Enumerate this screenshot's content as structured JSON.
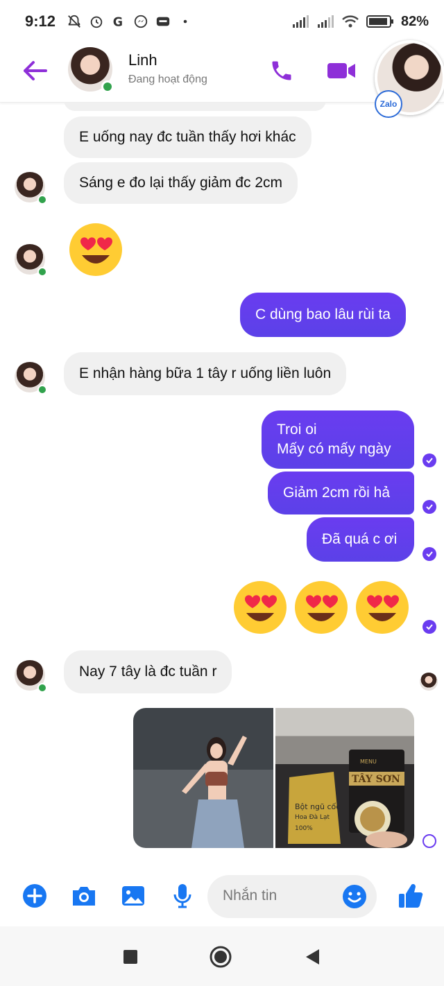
{
  "status_bar": {
    "time": "9:12",
    "battery": "82%"
  },
  "header": {
    "contact_name": "Linh",
    "contact_status": "Đang hoạt động",
    "accent_color": "#8e2fd8"
  },
  "float_bubble": {
    "badge": "Zalo"
  },
  "messages": [
    {
      "from": "them",
      "text": "E uống nay đc tuần thấy hơi khác"
    },
    {
      "from": "them",
      "text": "Sáng e đo lại thấy giảm đc 2cm"
    },
    {
      "from": "them",
      "type": "emoji",
      "emoji": "heart-eyes"
    },
    {
      "from": "me",
      "text": "C dùng bao lâu rùi ta"
    },
    {
      "from": "them",
      "text": "E nhận hàng bữa 1 tây r uống liền luôn"
    },
    {
      "from": "me",
      "lines": [
        "Troi oi",
        "Mấy có mấy ngày"
      ]
    },
    {
      "from": "me",
      "text": "Giảm 2cm rồi hả"
    },
    {
      "from": "me",
      "text": "Đã quá c ơi"
    },
    {
      "from": "me",
      "type": "emoji",
      "emoji": "heart-eyes",
      "count": 3
    },
    {
      "from": "them",
      "text": "Nay 7 tây là đc tuần r"
    },
    {
      "from": "me",
      "type": "photos",
      "count": 2
    }
  ],
  "photo_labels": {
    "menu": "MENU",
    "brand": "TÂY SƠN",
    "pack_line1": "Bột ngũ cốc",
    "pack_line2": "Hoa Đà Lạt",
    "pack_pct": "100%"
  },
  "composer": {
    "placeholder": "Nhắn tin"
  },
  "colors": {
    "outgoing_bubble": "#6a3cf0",
    "incoming_bubble": "#f0f0f0",
    "online": "#31a24c",
    "composer_icons": "#1877f2"
  }
}
